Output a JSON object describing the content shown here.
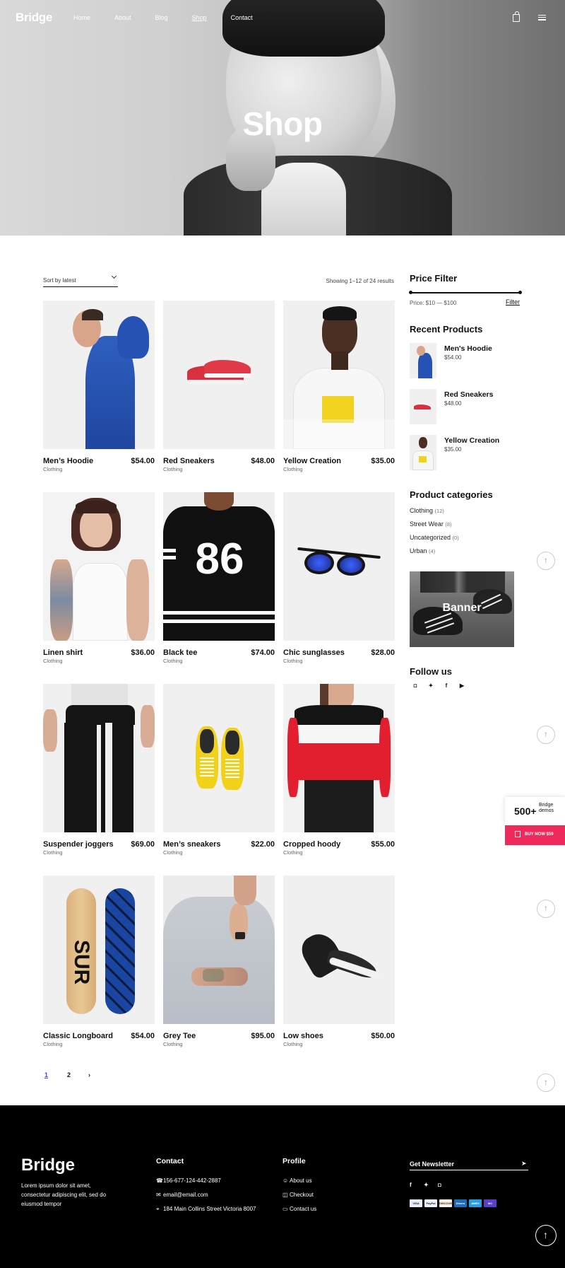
{
  "nav": {
    "logo": "Bridge",
    "links": [
      "Home",
      "About",
      "Blog",
      "Shop",
      "Contact"
    ],
    "active": "Shop"
  },
  "hero": {
    "title": "Shop"
  },
  "toolbar": {
    "sort_label": "Sort by latest",
    "results": "Showing 1–12 of 24 results"
  },
  "products": [
    {
      "name": "Men’s Hoodie",
      "price": "$54.00",
      "category": "Clothing"
    },
    {
      "name": "Red Sneakers",
      "price": "$48.00",
      "category": "Clothing"
    },
    {
      "name": "Yellow Creation",
      "price": "$35.00",
      "category": "Clothing"
    },
    {
      "name": "Linen shirt",
      "price": "$36.00",
      "category": "Clothing"
    },
    {
      "name": "Black tee",
      "price": "$74.00",
      "category": "Clothing"
    },
    {
      "name": "Chic sunglasses",
      "price": "$28.00",
      "category": "Clothing"
    },
    {
      "name": "Suspender joggers",
      "price": "$69.00",
      "category": "Clothing"
    },
    {
      "name": "Men’s sneakers",
      "price": "$22.00",
      "category": "Clothing"
    },
    {
      "name": "Cropped hoody",
      "price": "$55.00",
      "category": "Clothing"
    },
    {
      "name": "Classic Longboard",
      "price": "$54.00",
      "category": "Clothing"
    },
    {
      "name": "Grey Tee",
      "price": "$95.00",
      "category": "Clothing"
    },
    {
      "name": "Low shoes",
      "price": "$50.00",
      "category": "Clothing"
    }
  ],
  "product_art": {
    "tee_number": "86",
    "board_text": "SUR"
  },
  "pagination": {
    "pages": [
      "1",
      "2"
    ],
    "next": "›",
    "current": "1"
  },
  "sidebar": {
    "price_filter": {
      "title": "Price Filter",
      "range": "Price: $10 — $100",
      "button": "Filter",
      "min": 10,
      "max": 100
    },
    "recent": {
      "title": "Recent Products",
      "items": [
        {
          "name": "Men's Hoodie",
          "price": "$54.00"
        },
        {
          "name": "Red Sneakers",
          "price": "$48.00"
        },
        {
          "name": "Yellow Creation",
          "price": "$35.00"
        }
      ]
    },
    "categories": {
      "title": "Product categories",
      "items": [
        {
          "name": "Clothing",
          "count": "(12)"
        },
        {
          "name": "Street Wear",
          "count": "(8)"
        },
        {
          "name": "Uncategorized",
          "count": "(0)"
        },
        {
          "name": "Urban",
          "count": "(4)"
        }
      ]
    },
    "banner": {
      "text": "Banner"
    },
    "follow": {
      "title": "Follow us",
      "icons": [
        "instagram-icon",
        "twitter-icon",
        "facebook-icon",
        "youtube-icon"
      ]
    }
  },
  "floating": {
    "demos_number": "500+",
    "demos_label": "Bridge demos",
    "buy_label": "BUY NOW $59"
  },
  "footer": {
    "logo": "Bridge",
    "text": "Lorem ipsum dolor sit amet, consectetur adipiscing elit, sed do eiusmod tempor",
    "contact": {
      "title": "Contact",
      "phone": "156-677-124-442-2887",
      "email": "email@email.com",
      "address": "184 Main Collins Street Victoria 8007"
    },
    "profile": {
      "title": "Profile",
      "links": [
        "About us",
        "Checkout",
        "Contact us"
      ]
    },
    "newsletter": {
      "title": "Get Newsletter"
    },
    "cards": [
      "VISA",
      "PayPal",
      "DISCOVER",
      "Diners",
      "AMEX",
      "MC"
    ]
  },
  "colors": {
    "accent": "#ef2a5a",
    "pagination_active": "#4a3cff",
    "footer_bg": "#000000"
  }
}
